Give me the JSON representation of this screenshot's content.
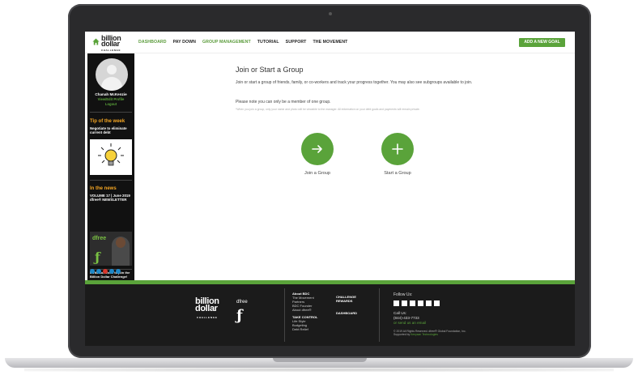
{
  "header": {
    "logo_line1": "billion",
    "logo_line2": "dollar",
    "logo_sub": "CHALLENGE",
    "nav": [
      {
        "label": "DASHBOARD",
        "active": true
      },
      {
        "label": "PAY DOWN",
        "active": false
      },
      {
        "label": "GROUP MANAGEMENT",
        "active": true
      },
      {
        "label": "TUTORIAL",
        "active": false
      },
      {
        "label": "SUPPORT",
        "active": false
      },
      {
        "label": "THE MOVEMENT",
        "active": false
      }
    ],
    "cta": "ADD A NEW GOAL"
  },
  "sidebar": {
    "user_name": "Chanah McKenzie",
    "edit_profile": "View/Edit Profile",
    "logout": "Logout",
    "tip_heading": "Tip of the week",
    "tip_text": "Negotiate to eliminate current debt",
    "news_heading": "In the news",
    "news_text": "VOLUME 17 | June 2019 dfree® NEWSLETTER",
    "news_image_brand": "dfree",
    "invite_text": "Invite someone to join the Billion Dollar Challenge!"
  },
  "main": {
    "title": "Join or Start a Group",
    "intro": "Join or start a group of friends, family, or co-workers and track your progress together. You may also see subgroups available to join.",
    "note": "Please note you can only be a member of one group.",
    "fine_print": "*When you join a group, only your name and photo will be viewable to the manager. All information on your debt goals and payments will remain private.",
    "join_label": "Join a Group",
    "start_label": "Start a Group"
  },
  "footer": {
    "logo_line1": "billion",
    "logo_line2": "dollar",
    "logo_sub": "CHALLENGE",
    "dfree_label": "dfree",
    "col1": {
      "heading": "About BDC",
      "links": [
        "The Movement",
        "Partners",
        "BDC Founder",
        "About dfree®"
      ],
      "heading2": "TAKE CONTROL",
      "links2": [
        "Life Style",
        "Budgeting",
        "Debt Relief"
      ]
    },
    "col2": {
      "heading": "CHALLENGE REWARDS",
      "heading2": "DASHBOARD"
    },
    "follow": "Follow Us:",
    "call_label": "Call Us:",
    "phone": "(844)-433-7733",
    "email_link": "or send us an email",
    "copyright": "© 2019 All Rights Reserved. dfree® Global Foundation, Inc.",
    "supported": "Supported by",
    "supporter": "Kenysan Technologies"
  },
  "colors": {
    "accent": "#5aa33a",
    "sidebar_bg": "#111111",
    "footer_bg": "#1b1b1b",
    "tip_heading": "#f5a623"
  }
}
